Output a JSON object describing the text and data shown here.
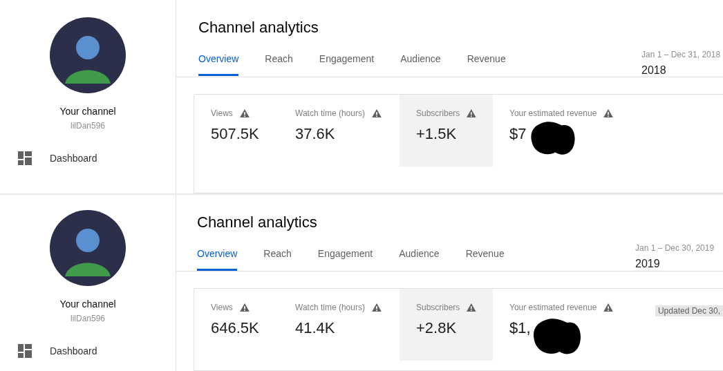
{
  "panels": [
    {
      "sidebar": {
        "channel_label": "Your channel",
        "handle": "lilDan596",
        "nav_items": [
          {
            "label": "Dashboard"
          }
        ]
      },
      "title": "Channel analytics",
      "tabs": [
        {
          "label": "Overview",
          "selected": true
        },
        {
          "label": "Reach",
          "selected": false
        },
        {
          "label": "Engagement",
          "selected": false
        },
        {
          "label": "Audience",
          "selected": false
        },
        {
          "label": "Revenue",
          "selected": false
        }
      ],
      "date_range": "Jan 1 – Dec 31, 2018",
      "year": "2018",
      "metrics": [
        {
          "label": "Views",
          "value": "507.5K",
          "selected": false,
          "redacted": false
        },
        {
          "label": "Watch time (hours)",
          "value": "37.6K",
          "selected": false,
          "redacted": false
        },
        {
          "label": "Subscribers",
          "value": "+1.5K",
          "selected": true,
          "redacted": false
        },
        {
          "label": "Your estimated revenue",
          "value": "$7",
          "selected": false,
          "redacted": true
        }
      ]
    },
    {
      "sidebar": {
        "channel_label": "Your channel",
        "handle": "lilDan596",
        "nav_items": [
          {
            "label": "Dashboard"
          }
        ]
      },
      "title": "Channel analytics",
      "tabs": [
        {
          "label": "Overview",
          "selected": true
        },
        {
          "label": "Reach",
          "selected": false
        },
        {
          "label": "Engagement",
          "selected": false
        },
        {
          "label": "Audience",
          "selected": false
        },
        {
          "label": "Revenue",
          "selected": false
        }
      ],
      "date_range": "Jan 1 – Dec 30, 2019",
      "year": "2019",
      "metrics": [
        {
          "label": "Views",
          "value": "646.5K",
          "selected": false,
          "redacted": false
        },
        {
          "label": "Watch time (hours)",
          "value": "41.4K",
          "selected": false,
          "redacted": false
        },
        {
          "label": "Subscribers",
          "value": "+2.8K",
          "selected": true,
          "redacted": false
        },
        {
          "label": "Your estimated revenue",
          "value": "$1,",
          "selected": false,
          "redacted": true
        }
      ],
      "updated": "Updated Dec 30,"
    }
  ]
}
